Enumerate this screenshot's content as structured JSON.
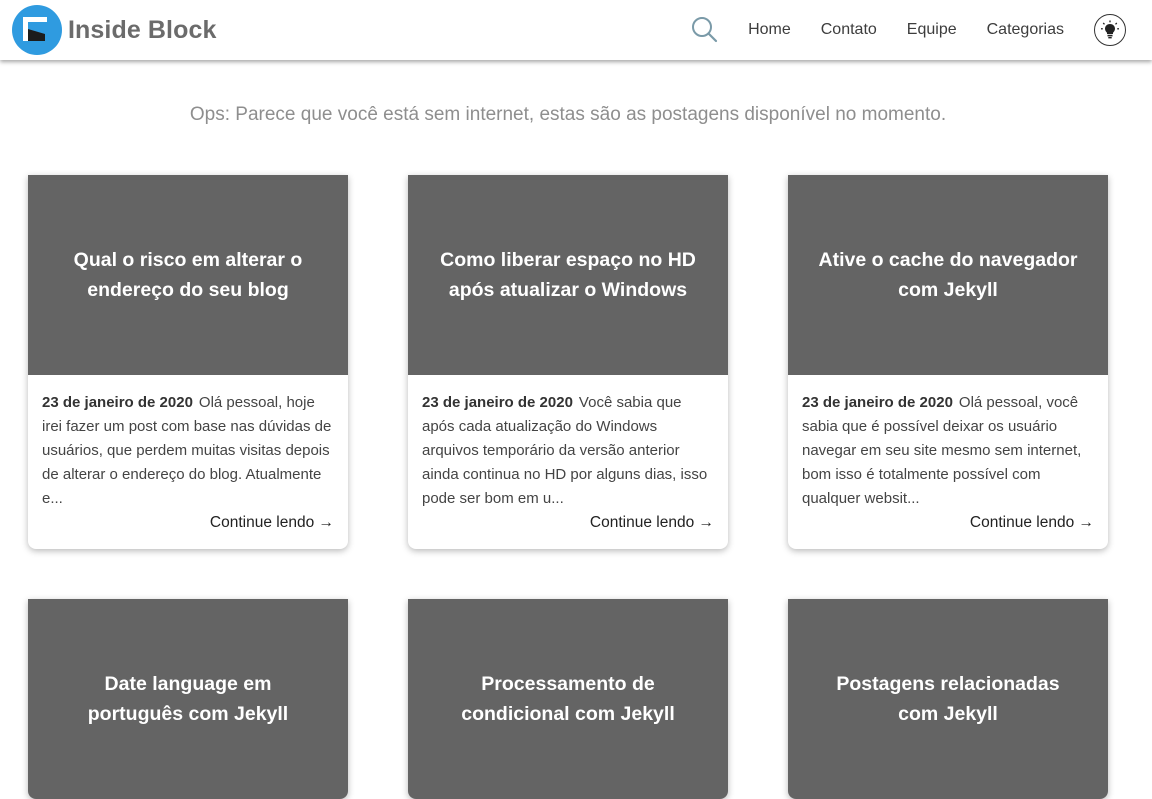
{
  "header": {
    "brand_name": "Inside Block",
    "nav": {
      "home": "Home",
      "contact": "Contato",
      "team": "Equipe",
      "categories": "Categorias"
    },
    "icons": {
      "logo": "logo-icon",
      "search": "search-icon",
      "theme": "lightbulb-icon"
    },
    "colors": {
      "logo_blue": "#2f9be0",
      "brand_text": "#6b6b6b"
    }
  },
  "notice": "Ops: Parece que você está sem internet, estas são as postagens disponível no momento.",
  "posts": [
    {
      "title": "Qual o risco em alterar o endereço do seu blog",
      "date": "23 de janeiro de 2020",
      "excerpt": "Olá pessoal, hoje irei fazer um post com base nas dúvidas de usuários, que perdem muitas visitas depois de alterar o endereço do blog. Atualmente e...",
      "more": "Continue lendo →"
    },
    {
      "title": "Como liberar espaço no HD após atualizar o Windows",
      "date": "23 de janeiro de 2020",
      "excerpt": "Você sabia que após cada atualização do Windows arquivos temporário da versão anterior ainda continua no HD por alguns dias, isso pode ser bom em u...",
      "more": "Continue lendo →"
    },
    {
      "title": "Ative o cache do navegador com Jekyll",
      "date": "23 de janeiro de 2020",
      "excerpt": "Olá pessoal, você sabia que é possível deixar os usuário navegar em seu site mesmo sem internet, bom isso é totalmente possível com qualquer websit...",
      "more": "Continue lendo →"
    },
    {
      "title": "Date language em português com Jekyll"
    },
    {
      "title": "Processamento de condicional com Jekyll"
    },
    {
      "title": "Postagens relacionadas com Jekyll"
    }
  ],
  "colors": {
    "card_cover": "#646464",
    "notice_text": "#8e8e8e"
  }
}
